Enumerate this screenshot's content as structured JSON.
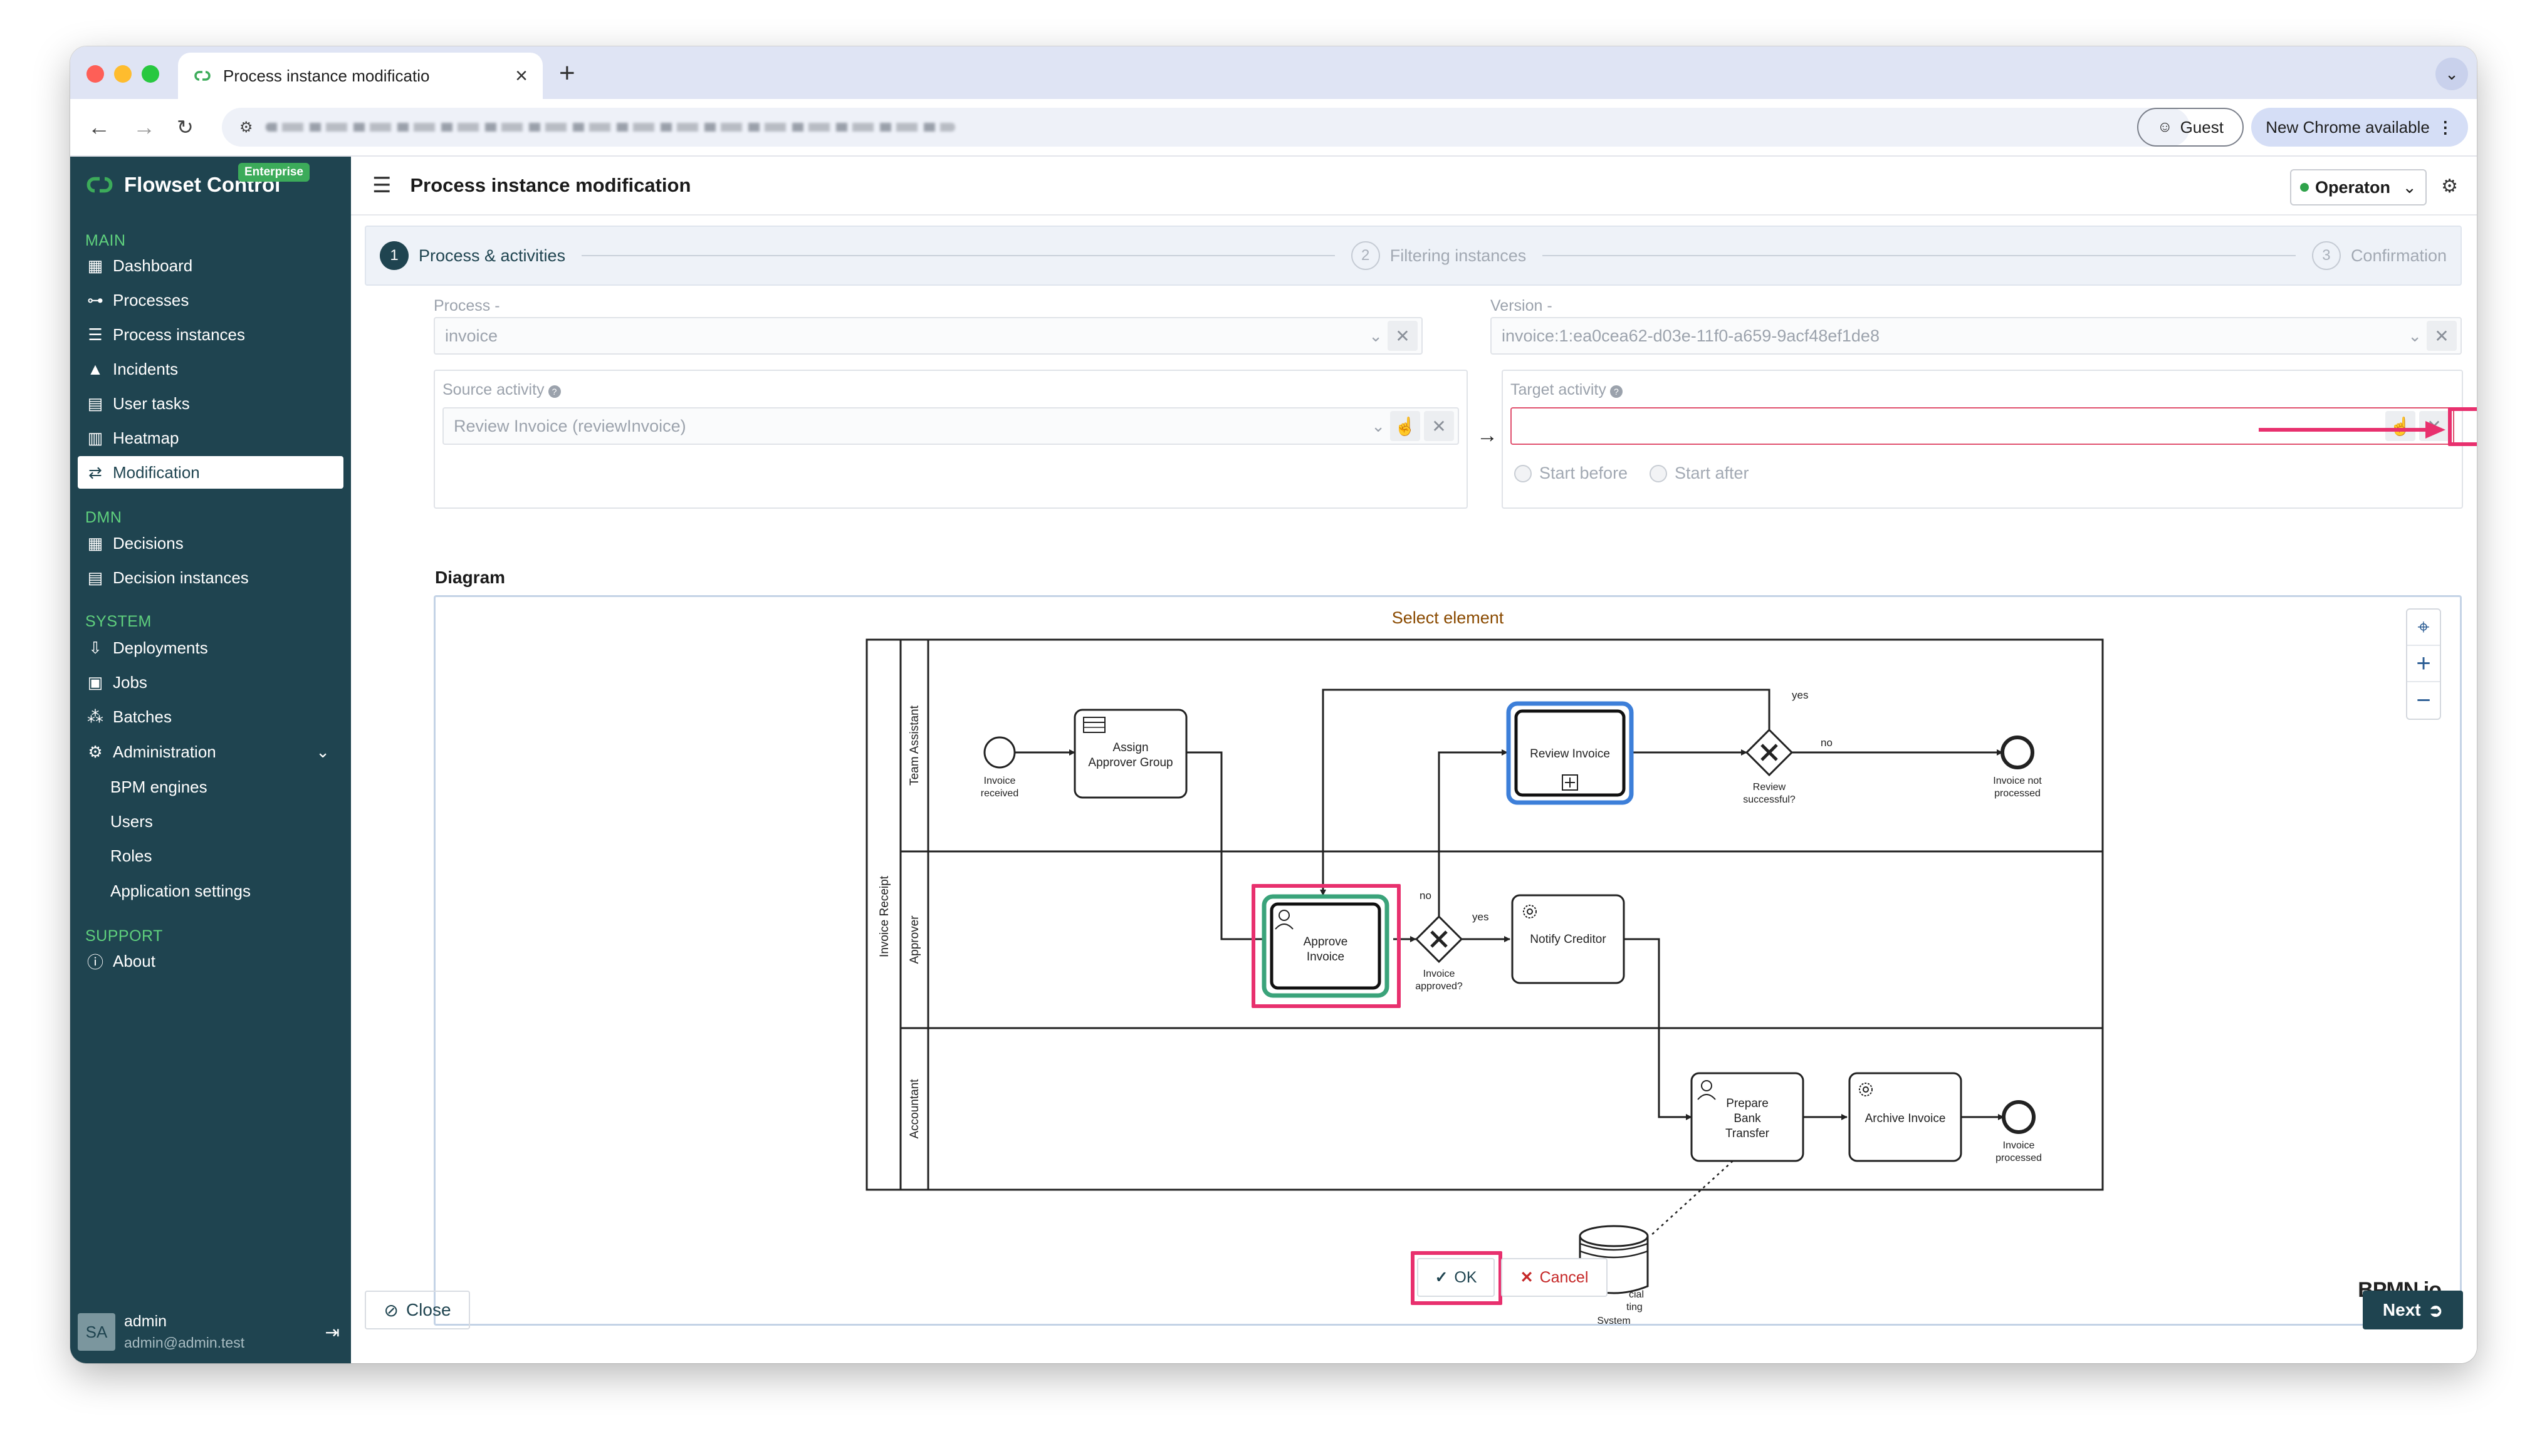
{
  "browser": {
    "tab_title": "Process instance modificatio",
    "guest_label": "Guest",
    "new_chrome_label": "New Chrome available"
  },
  "sidebar": {
    "brand": "Flowset Control",
    "badge": "Enterprise",
    "sections": {
      "main": "MAIN",
      "dmn": "DMN",
      "system": "SYSTEM",
      "support": "SUPPORT"
    },
    "items": {
      "dashboard": "Dashboard",
      "processes": "Processes",
      "process_instances": "Process instances",
      "incidents": "Incidents",
      "user_tasks": "User tasks",
      "heatmap": "Heatmap",
      "modification": "Modification",
      "decisions": "Decisions",
      "decision_instances": "Decision instances",
      "deployments": "Deployments",
      "jobs": "Jobs",
      "batches": "Batches",
      "administration": "Administration",
      "bpm_engines": "BPM engines",
      "users": "Users",
      "roles": "Roles",
      "application_settings": "Application settings",
      "about": "About"
    },
    "user": {
      "initials": "SA",
      "name": "admin",
      "email": "admin@admin.test"
    }
  },
  "header": {
    "title": "Process instance modification",
    "engine": "Operaton"
  },
  "steps": [
    {
      "num": "1",
      "label": "Process & activities",
      "active": true
    },
    {
      "num": "2",
      "label": "Filtering instances",
      "active": false
    },
    {
      "num": "3",
      "label": "Confirmation",
      "active": false
    }
  ],
  "form": {
    "process_label": "Process -",
    "process_value": "invoice",
    "version_label": "Version -",
    "version_value": "invoice:1:ea0cea62-d03e-11f0-a659-9acf48ef1de8",
    "source_label": "Source activity",
    "source_value": "Review Invoice (reviewInvoice)",
    "target_label": "Target activity",
    "target_value": "",
    "start_before": "Start before",
    "start_after": "Start after"
  },
  "diagram": {
    "heading": "Diagram",
    "hint": "Select element",
    "pool": "Invoice Receipt",
    "lanes": [
      "Team Assistant",
      "Approver",
      "Accountant"
    ],
    "tasks": {
      "assign": [
        "Assign",
        "Approver Group"
      ],
      "review": "Review Invoice",
      "approve": [
        "Approve",
        "Invoice"
      ],
      "notify": "Notify Creditor",
      "prepare": [
        "Prepare",
        "Bank",
        "Transfer"
      ],
      "archive": "Archive Invoice"
    },
    "events": {
      "received": [
        "Invoice",
        "received"
      ],
      "not_processed": [
        "Invoice not",
        "processed"
      ],
      "processed": [
        "Invoice",
        "processed"
      ]
    },
    "gateways": {
      "review_successful": [
        "Review",
        "successful?"
      ],
      "invoice_approved": [
        "Invoice",
        "approved?"
      ]
    },
    "flow_labels": {
      "yes1": "yes",
      "no1": "no",
      "no2": "no",
      "yes2": "yes"
    },
    "datastore": [
      "cial",
      "ting",
      "System"
    ],
    "ok": "OK",
    "cancel": "Cancel",
    "watermark": "BPMN.io"
  },
  "footer": {
    "close": "Close",
    "next": "Next"
  },
  "colors": {
    "sidebar_bg": "#1f4450",
    "accent_green": "#3cab5a",
    "highlight": "#e8306e",
    "selected_blue": "#3d7fd9",
    "selected_green": "#3aa37a"
  }
}
